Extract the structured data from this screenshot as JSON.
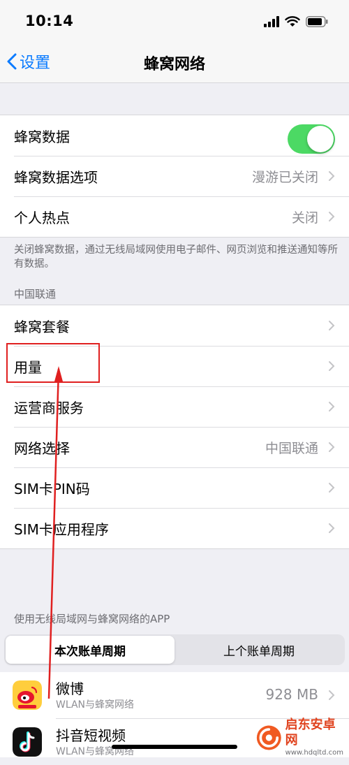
{
  "status": {
    "time": "10:14"
  },
  "nav": {
    "back_label": "设置",
    "title": "蜂窝网络"
  },
  "group1": {
    "cellular_data": {
      "label": "蜂窝数据",
      "toggle_on": true
    },
    "cellular_options": {
      "label": "蜂窝数据选项",
      "value": "漫游已关闭"
    },
    "hotspot": {
      "label": "个人热点",
      "value": "关闭"
    }
  },
  "footnote": "关闭蜂窝数据，通过无线局域网使用电子邮件、网页浏览和推送通知等所有数据。",
  "carrier_header": "中国联通",
  "group2": {
    "plan": {
      "label": "蜂窝套餐"
    },
    "usage": {
      "label": "用量"
    },
    "carrier_services": {
      "label": "运营商服务"
    },
    "network_selection": {
      "label": "网络选择",
      "value": "中国联通"
    },
    "sim_pin": {
      "label": "SIM卡PIN码"
    },
    "sim_apps": {
      "label": "SIM卡应用程序"
    }
  },
  "apps_header": "使用无线局域网与蜂窝网络的APP",
  "segmented": {
    "current": "本次账单周期",
    "previous": "上个账单周期"
  },
  "apps": [
    {
      "name": "微博",
      "subtitle": "WLAN与蜂窝网络",
      "size": "928 MB",
      "icon": "weibo-icon"
    },
    {
      "name": "抖音短视频",
      "subtitle": "WLAN与蜂窝网络",
      "size": "",
      "icon": "douyin-icon"
    }
  ],
  "watermark": {
    "title": "启东安卓网",
    "url": "www.hdqltd.com"
  },
  "colors": {
    "accent": "#0a7bff",
    "toggle_on": "#4cd964",
    "annotation": "#e02020",
    "background": "#efeff4"
  }
}
